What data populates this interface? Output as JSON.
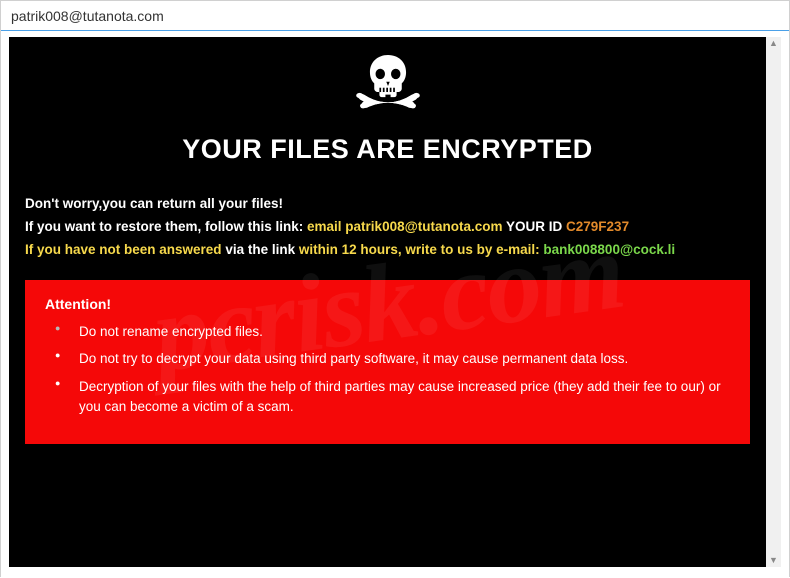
{
  "window": {
    "title": "patrik008@tutanota.com"
  },
  "headline": "YOUR FILES ARE ENCRYPTED",
  "intro": {
    "line1": "Don't worry,you can return all your files!",
    "line2_prefix": "If you want to restore them, follow this link: ",
    "line2_email_label": "email patrik008@tutanota.com",
    "line2_id_label": "  YOUR ID ",
    "line2_id_value": "C279F237",
    "line3_prefix": "If you have not been answered ",
    "line3_mid": "via the link ",
    "line3_within": "within 12 hours, write to us by e-mail: ",
    "line3_email": "bank008800@cock.li"
  },
  "attention": {
    "label": "Attention!",
    "items": [
      "Do not rename encrypted files.",
      "Do not try to decrypt your data using third party software, it may cause permanent data loss.",
      "Decryption of your files with the help of third parties may cause increased price (they add their fee to our) or you can become a victim of a scam."
    ]
  },
  "watermark": "pcrisk.com"
}
